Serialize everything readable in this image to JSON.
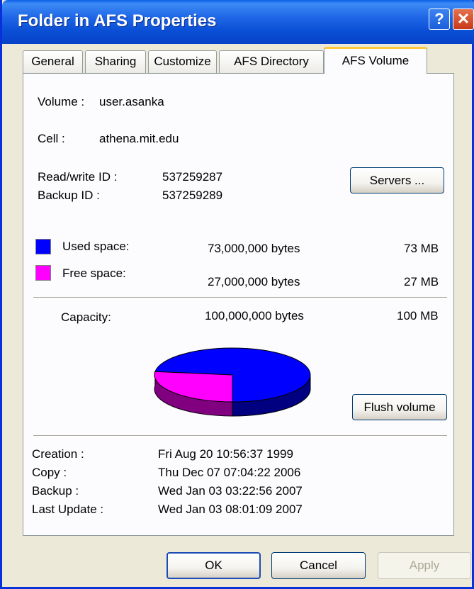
{
  "window": {
    "title": "Folder in AFS Properties",
    "help_glyph": "?",
    "close_glyph": "✕"
  },
  "tabs": [
    {
      "label": "General"
    },
    {
      "label": "Sharing"
    },
    {
      "label": "Customize"
    },
    {
      "label": "AFS Directory"
    },
    {
      "label": "AFS Volume",
      "active": true
    }
  ],
  "volume": {
    "volume_label": "Volume :",
    "volume_value": "user.asanka",
    "cell_label": "Cell :",
    "cell_value": "athena.mit.edu",
    "rw_id_label": "Read/write ID :",
    "rw_id_value": "537259287",
    "backup_id_label": "Backup ID :",
    "backup_id_value": "537259289",
    "servers_button": "Servers ..."
  },
  "space": {
    "used_label": "Used space:",
    "used_bytes": "73,000,000 bytes",
    "used_mb": "73 MB",
    "used_color": "#0000FF",
    "free_label": "Free space:",
    "free_bytes": "27,000,000 bytes",
    "free_mb": "27 MB",
    "free_color": "#FF00FF",
    "capacity_label": "Capacity:",
    "capacity_bytes": "100,000,000 bytes",
    "capacity_mb": "100 MB",
    "used_fraction": 0.73,
    "flush_button": "Flush volume"
  },
  "dates": [
    {
      "label": "Creation :",
      "value": "Fri Aug 20 10:56:37 1999"
    },
    {
      "label": "Copy :",
      "value": "Thu Dec 07 07:04:22 2006"
    },
    {
      "label": "Backup :",
      "value": "Wed Jan 03 03:22:56 2007"
    },
    {
      "label": "Last Update :",
      "value": "Wed Jan 03 08:01:09 2007"
    }
  ],
  "buttons": {
    "ok": "OK",
    "cancel": "Cancel",
    "apply": "Apply"
  }
}
